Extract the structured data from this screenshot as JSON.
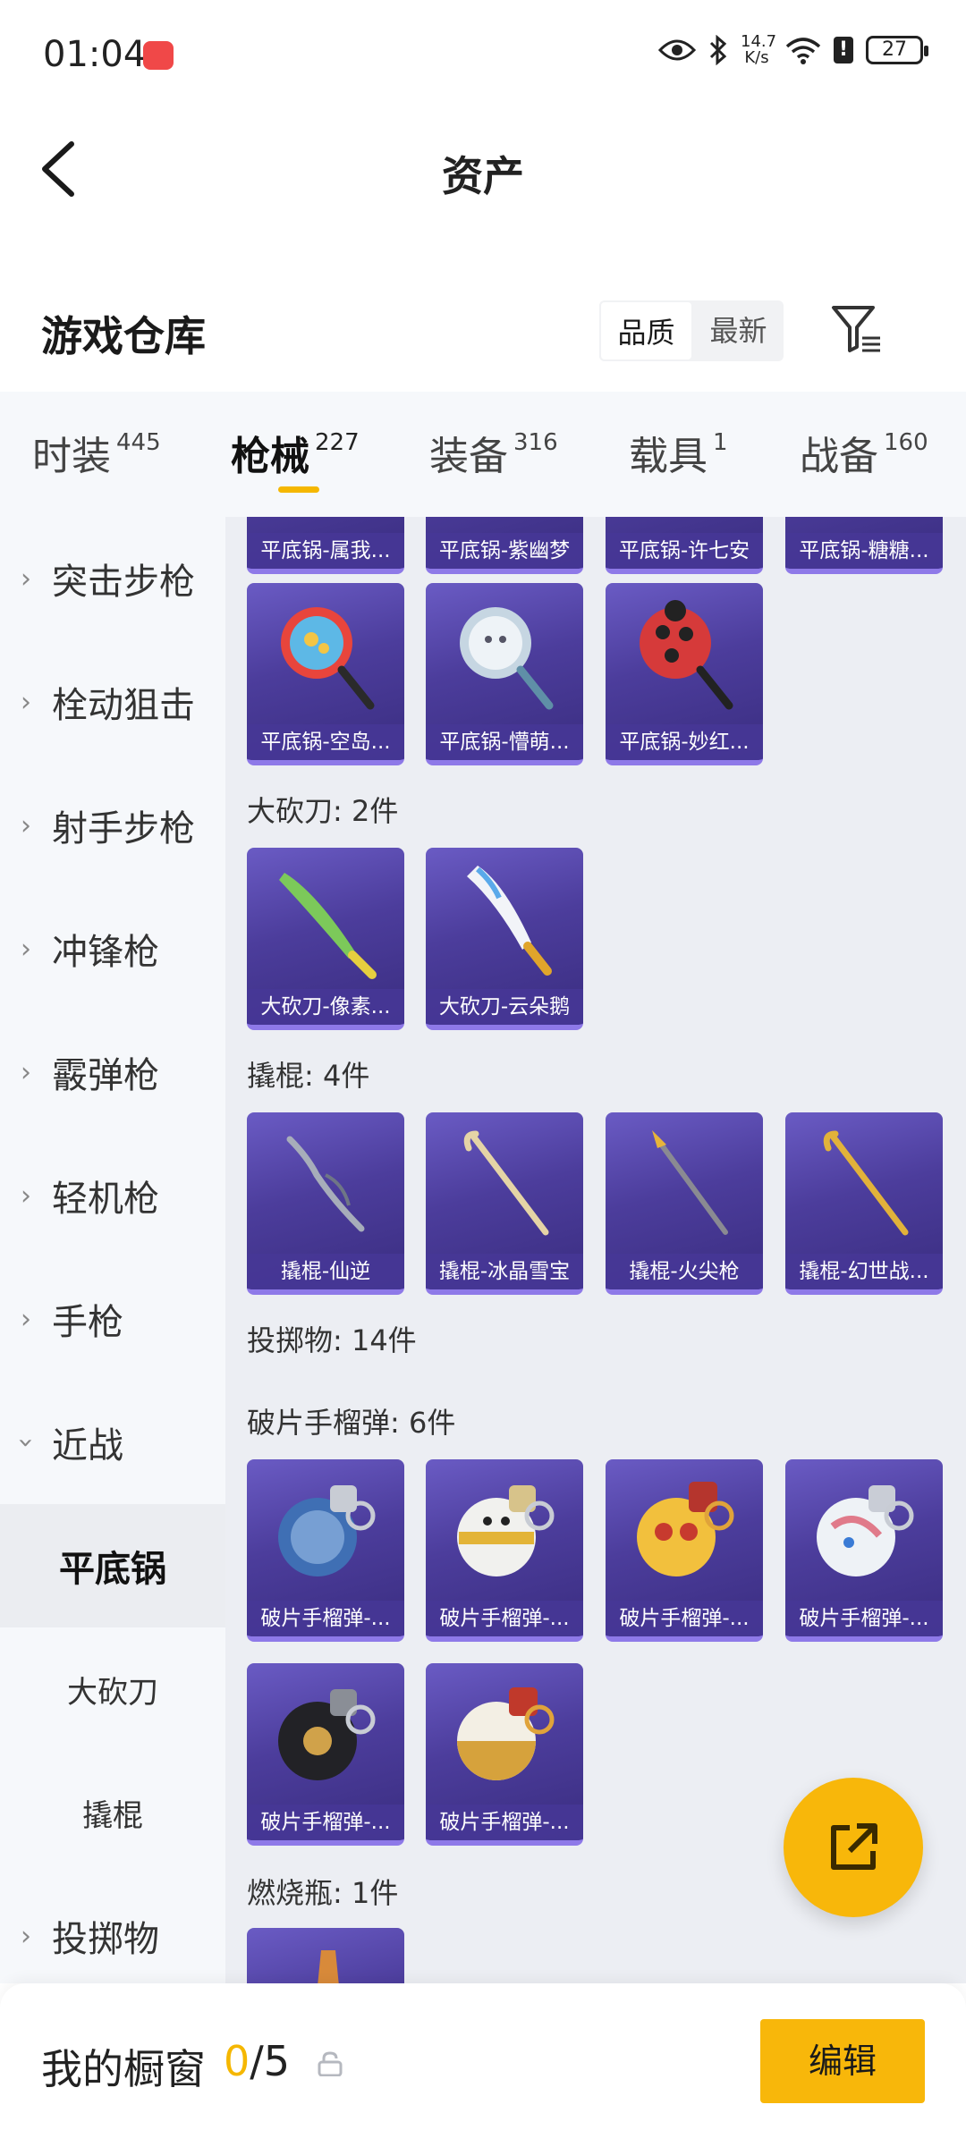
{
  "status": {
    "time": "01:04",
    "speed_top": "14.7",
    "speed_bottom": "K/s",
    "battery": "27"
  },
  "header": {
    "title": "资产"
  },
  "warehouse": {
    "title": "游戏仓库",
    "sort_quality": "品质",
    "sort_latest": "最新"
  },
  "tabs": [
    {
      "label": "时装",
      "count": "445"
    },
    {
      "label": "枪械",
      "count": "227"
    },
    {
      "label": "装备",
      "count": "316"
    },
    {
      "label": "载具",
      "count": "1"
    },
    {
      "label": "战备",
      "count": "160"
    }
  ],
  "sidebar": [
    "突击步枪",
    "栓动狙击",
    "射手步枪",
    "冲锋枪",
    "霰弹枪",
    "轻机枪",
    "手枪",
    "近战",
    "平底锅",
    "大砍刀",
    "撬棍",
    "投掷物"
  ],
  "content": {
    "pan_row1": [
      "平底锅-属我...",
      "平底锅-紫幽梦",
      "平底锅-许七安",
      "平底锅-糖糖..."
    ],
    "pan_row2": [
      "平底锅-空岛...",
      "平底锅-懵萌...",
      "平底锅-妙红..."
    ],
    "machete_label": "大砍刀: 2件",
    "machete": [
      "大砍刀-像素...",
      "大砍刀-云朵鹅"
    ],
    "crowbar_label": "撬棍: 4件",
    "crowbar": [
      "撬棍-仙逆",
      "撬棍-冰晶雪宝",
      "撬棍-火尖枪",
      "撬棍-幻世战..."
    ],
    "throw_label": "投掷物: 14件",
    "frag_label": "破片手榴弹: 6件",
    "frag": [
      "破片手榴弹-...",
      "破片手榴弹-...",
      "破片手榴弹-...",
      "破片手榴弹-...",
      "破片手榴弹-...",
      "破片手榴弹-..."
    ],
    "molotov_label": "燃烧瓶: 1件"
  },
  "bottom": {
    "title": "我的橱窗",
    "count_current": "0",
    "count_total": "/5",
    "edit": "编辑"
  },
  "colors": {
    "accent": "#f8b70a",
    "card": "#4c3d9c"
  }
}
